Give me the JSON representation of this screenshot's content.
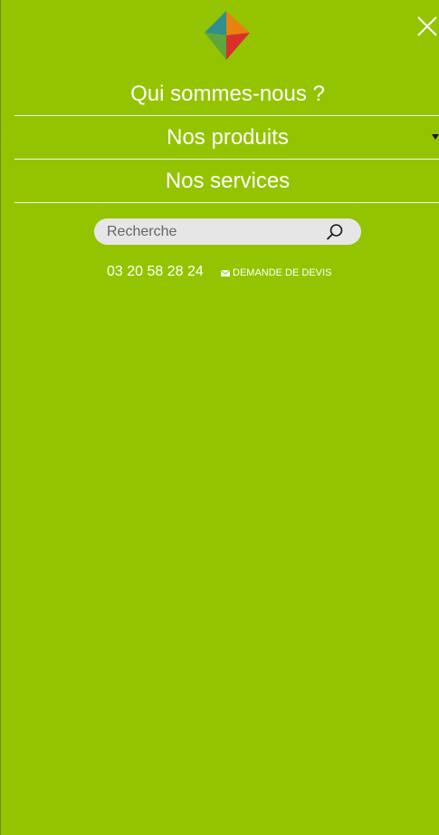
{
  "menu": {
    "items": [
      {
        "label": "Qui sommes-nous ?",
        "has_dropdown": false
      },
      {
        "label": "Nos produits",
        "has_dropdown": true
      },
      {
        "label": "Nos services",
        "has_dropdown": false
      }
    ]
  },
  "search": {
    "placeholder": "Recherche"
  },
  "contact": {
    "phone": "03 20 58 28 24",
    "quote_label": "DEMANDE DE DEVIS"
  },
  "colors": {
    "background": "#94c400",
    "text": "#ffffff",
    "search_bg": "#e6e6e6"
  },
  "icons": {
    "logo": "diamond-logo-icon",
    "close": "close-icon",
    "search": "search-icon",
    "mail": "mail-icon",
    "dropdown": "caret-down-icon"
  }
}
